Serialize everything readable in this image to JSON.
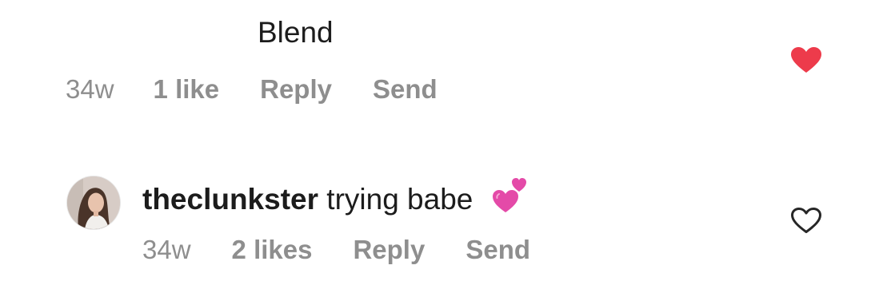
{
  "comment_1": {
    "text": "Blend",
    "time": "34w",
    "likes": "1 like",
    "reply_label": "Reply",
    "send_label": "Send",
    "liked": true,
    "heart_color": "#ed3b4b"
  },
  "comment_2": {
    "username": "theclunkster",
    "text": "trying babe",
    "emoji": "two-hearts-emoji",
    "time": "34w",
    "likes": "2 likes",
    "reply_label": "Reply",
    "send_label": "Send",
    "liked": false,
    "heart_color": "#262626"
  },
  "colors": {
    "meta_text": "#8e8e8e",
    "body_text": "#1c1c1c",
    "emoji_pink": "#e44aa8"
  }
}
